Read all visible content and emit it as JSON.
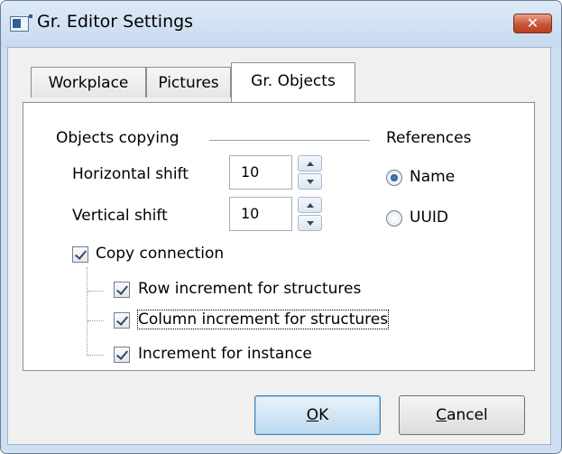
{
  "window": {
    "title": "Gr. Editor Settings",
    "close_glyph": "✕"
  },
  "tabs": [
    {
      "label": "Workplace",
      "active": false
    },
    {
      "label": "Pictures",
      "active": false
    },
    {
      "label": "Gr. Objects",
      "active": true
    }
  ],
  "objects_copying": {
    "group_label": "Objects copying",
    "horizontal_shift": {
      "label": "Horizontal shift",
      "value": "10"
    },
    "vertical_shift": {
      "label": "Vertical shift",
      "value": "10"
    },
    "copy_connection": {
      "label": "Copy connection",
      "checked": true
    },
    "sub_options": [
      {
        "label": "Row increment for structures",
        "checked": true
      },
      {
        "label": "Column increment for structures",
        "checked": true,
        "focused": true
      },
      {
        "label": "Increment for instance",
        "checked": true
      }
    ]
  },
  "references": {
    "group_label": "References",
    "options": [
      {
        "label": "Name",
        "selected": true
      },
      {
        "label": "UUID",
        "selected": false
      }
    ]
  },
  "buttons": {
    "ok": {
      "mnemonic": "O",
      "rest": "K"
    },
    "cancel": {
      "mnemonic": "C",
      "rest": "ancel"
    }
  }
}
